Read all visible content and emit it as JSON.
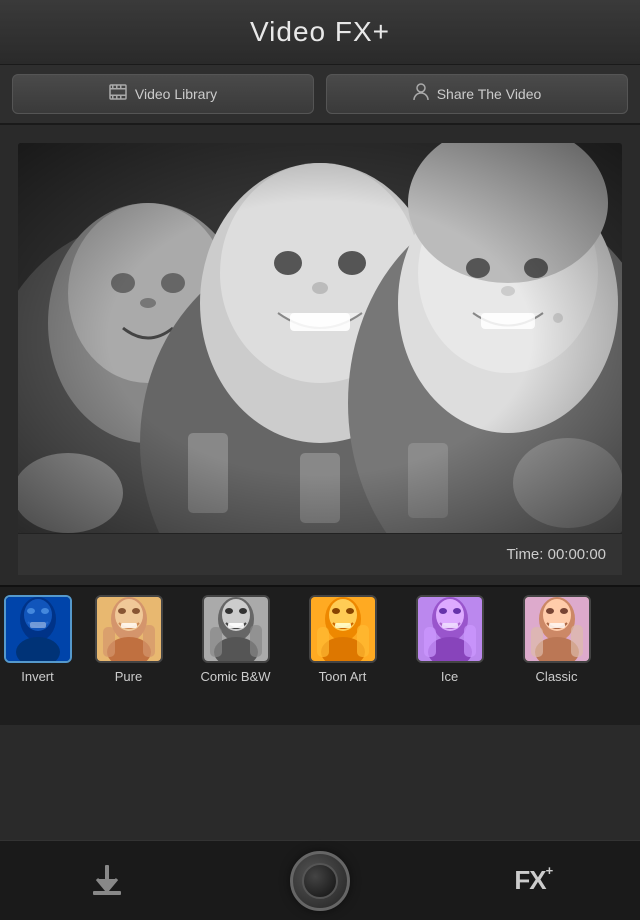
{
  "header": {
    "title": "Video FX+"
  },
  "toolbar": {
    "video_library_label": "Video Library",
    "share_video_label": "Share The Video"
  },
  "video": {
    "time_label": "Time:",
    "time_value": "00:00:00",
    "time_display": "Time: 00:00:00"
  },
  "fx_filters": [
    {
      "id": "invert",
      "label": "Invert",
      "active": true,
      "color": "invert"
    },
    {
      "id": "pure",
      "label": "Pure",
      "active": false,
      "color": "pure"
    },
    {
      "id": "comic-bw",
      "label": "Comic B&W",
      "active": false,
      "color": "comic"
    },
    {
      "id": "toon-art",
      "label": "Toon Art",
      "active": false,
      "color": "toon"
    },
    {
      "id": "ice",
      "label": "Ice",
      "active": false,
      "color": "ice"
    },
    {
      "id": "classic",
      "label": "Classic",
      "active": false,
      "color": "classic"
    }
  ],
  "bottom_toolbar": {
    "download_label": "Download",
    "camera_label": "Camera",
    "fx_label": "FX+"
  },
  "icons": {
    "film_icon": "▣",
    "person_icon": "👤",
    "download_icon": "⬇",
    "camera_icon": "📷",
    "fx_icon": "FX"
  }
}
